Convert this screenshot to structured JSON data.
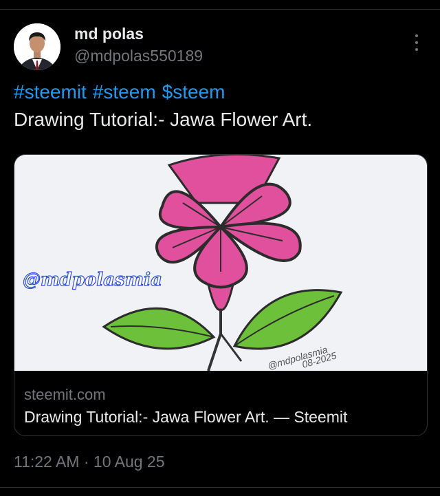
{
  "author": {
    "display_name": "md polas",
    "handle": "@mdpolas550189"
  },
  "tweet": {
    "hashtags": [
      "#steemit",
      "#steem",
      "$steem"
    ],
    "text": "Drawing Tutorial:- Jawa Flower Art."
  },
  "card": {
    "watermark": "@mdpolasmia",
    "signature": "@mdpolasmia",
    "signature_date": "08-2025",
    "domain": "steemit.com",
    "title": "Drawing Tutorial:- Jawa Flower Art. — Steemit"
  },
  "meta": {
    "timestamp": "11:22 AM · 10 Aug 25"
  },
  "colors": {
    "background": "#000000",
    "link": "#1d9bf0",
    "muted": "#71767b",
    "text": "#e7e9ea",
    "flower": "#e0509c",
    "leaf": "#6cc03a"
  },
  "icons": {
    "more": "more-vertical-icon"
  }
}
